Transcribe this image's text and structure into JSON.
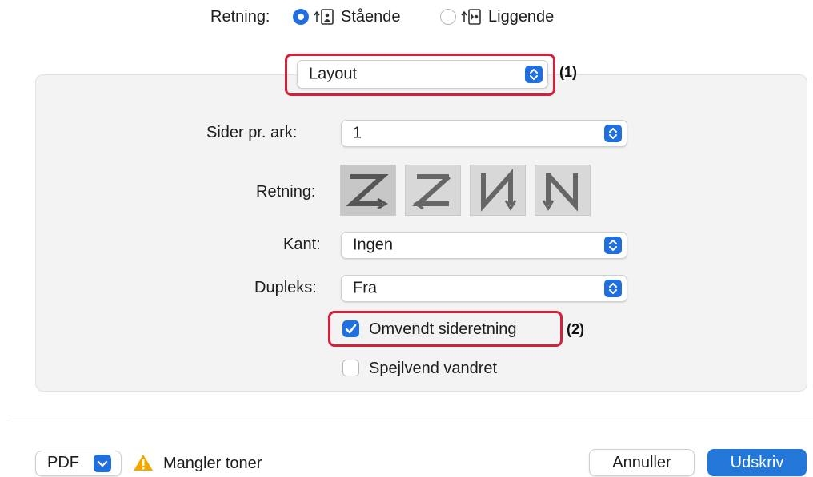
{
  "orientation": {
    "label": "Retning:",
    "options": [
      {
        "label": "Stående",
        "selected": true
      },
      {
        "label": "Liggende",
        "selected": false
      }
    ]
  },
  "section_select": {
    "value": "Layout",
    "callout": "(1)"
  },
  "settings": {
    "pages_per_sheet": {
      "label": "Sider pr. ark:",
      "value": "1"
    },
    "direction": {
      "label": "Retning:",
      "selected_index": 0
    },
    "border": {
      "label": "Kant:",
      "value": "Ingen"
    },
    "duplex": {
      "label": "Dupleks:",
      "value": "Fra"
    },
    "reverse_orientation": {
      "label": "Omvendt sideretning",
      "checked": true,
      "callout": "(2)"
    },
    "flip_horizontal": {
      "label": "Spejlvend vandret",
      "checked": false
    }
  },
  "footer": {
    "pdf_label": "PDF",
    "warning_text": "Mangler toner",
    "cancel_label": "Annuller",
    "print_label": "Udskriv"
  },
  "colors": {
    "accent": "#1f6fe0",
    "highlight": "#d5203a",
    "warning": "#f0a800"
  }
}
